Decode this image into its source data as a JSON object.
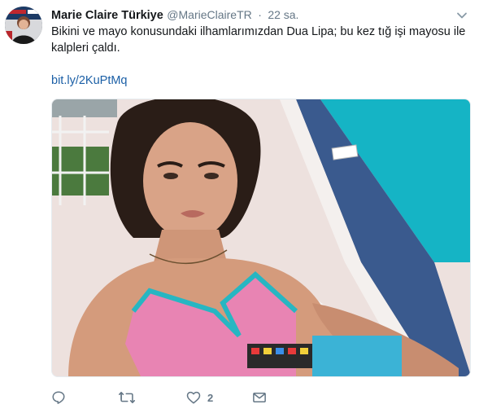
{
  "tweet": {
    "author": {
      "display_name": "Marie Claire Türkiye",
      "handle": "@MarieClaireTR",
      "separator": "·",
      "time": "22 sa."
    },
    "text": "Bikini ve mayo konusundaki ilhamlarımızdan Dua Lipa; bu kez tığ işi mayosu ile kalpleri çaldı.",
    "link": "bit.ly/2KuPtMq",
    "media": {
      "description_icon": "photo"
    },
    "actions": {
      "reply_icon": "reply-icon",
      "retweet_icon": "retweet-icon",
      "like_icon": "heart-icon",
      "like_count": "2",
      "dm_icon": "envelope-icon"
    },
    "colors": {
      "link": "#1b5fa6",
      "muted": "#657786",
      "text": "#14171a"
    }
  }
}
